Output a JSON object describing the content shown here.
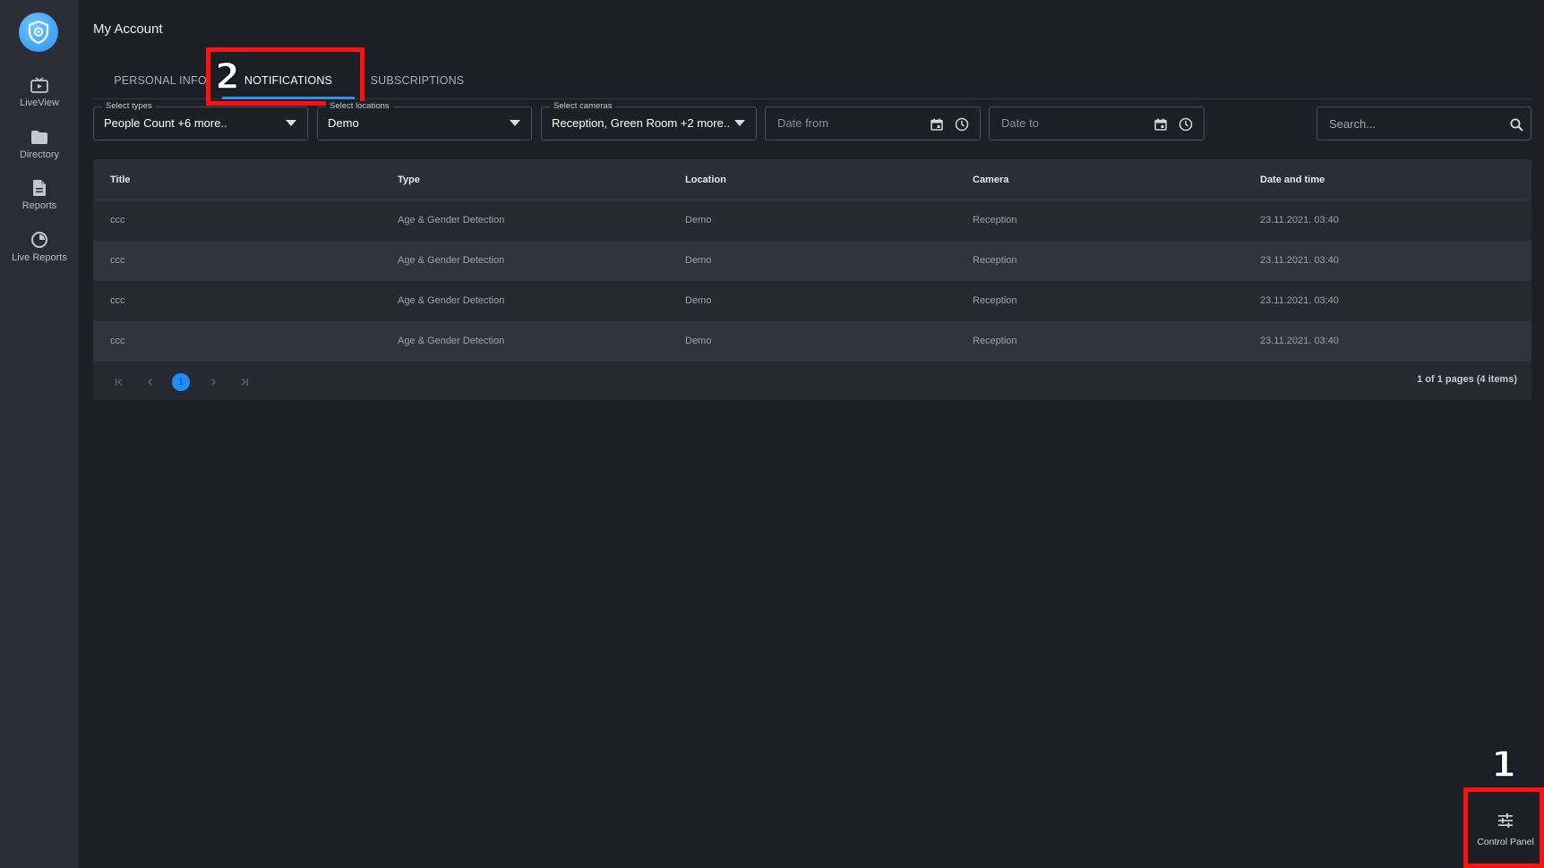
{
  "sidebar": {
    "logo": "shield-logo",
    "items": [
      {
        "label": "LiveView",
        "icon": "live-view-icon"
      },
      {
        "label": "Directory",
        "icon": "folder-icon"
      },
      {
        "label": "Reports",
        "icon": "document-icon"
      },
      {
        "label": "Live Reports",
        "icon": "live-reports-icon"
      }
    ]
  },
  "header": {
    "title": "My Account"
  },
  "tabs": [
    {
      "label": "PERSONAL INFO",
      "active": false
    },
    {
      "label": "NOTIFICATIONS",
      "active": true
    },
    {
      "label": "SUBSCRIPTIONS",
      "active": false
    }
  ],
  "filters": {
    "types": {
      "label": "Select types",
      "value": "People Count +6 more.."
    },
    "locations": {
      "label": "Select locations",
      "value": "Demo"
    },
    "cameras": {
      "label": "Select cameras",
      "value": "Reception, Green Room +2 more.."
    },
    "date_from": {
      "placeholder": "Date from"
    },
    "date_to": {
      "placeholder": "Date to"
    },
    "search": {
      "placeholder": "Search..."
    }
  },
  "table": {
    "columns": [
      "Title",
      "Type",
      "Location",
      "Camera",
      "Date and time"
    ],
    "rows": [
      [
        "ccc",
        "Age & Gender Detection",
        "Demo",
        "Reception",
        "23.11.2021. 03:40"
      ],
      [
        "ccc",
        "Age & Gender Detection",
        "Demo",
        "Reception",
        "23.11.2021. 03:40"
      ],
      [
        "ccc",
        "Age & Gender Detection",
        "Demo",
        "Reception",
        "23.11.2021. 03:40"
      ],
      [
        "ccc",
        "Age & Gender Detection",
        "Demo",
        "Reception",
        "23.11.2021. 03:40"
      ]
    ]
  },
  "pagination": {
    "current_page": "1",
    "info": "1 of 1 pages (4 items)"
  },
  "control_panel": {
    "label": "Control Panel",
    "icon": "sliders-icon"
  },
  "annotations": [
    "1",
    "2"
  ],
  "colors": {
    "accent": "#2d8ff0",
    "background": "#1d1f26",
    "sidebar": "#2a2d36",
    "annotation": "#ff1111"
  }
}
